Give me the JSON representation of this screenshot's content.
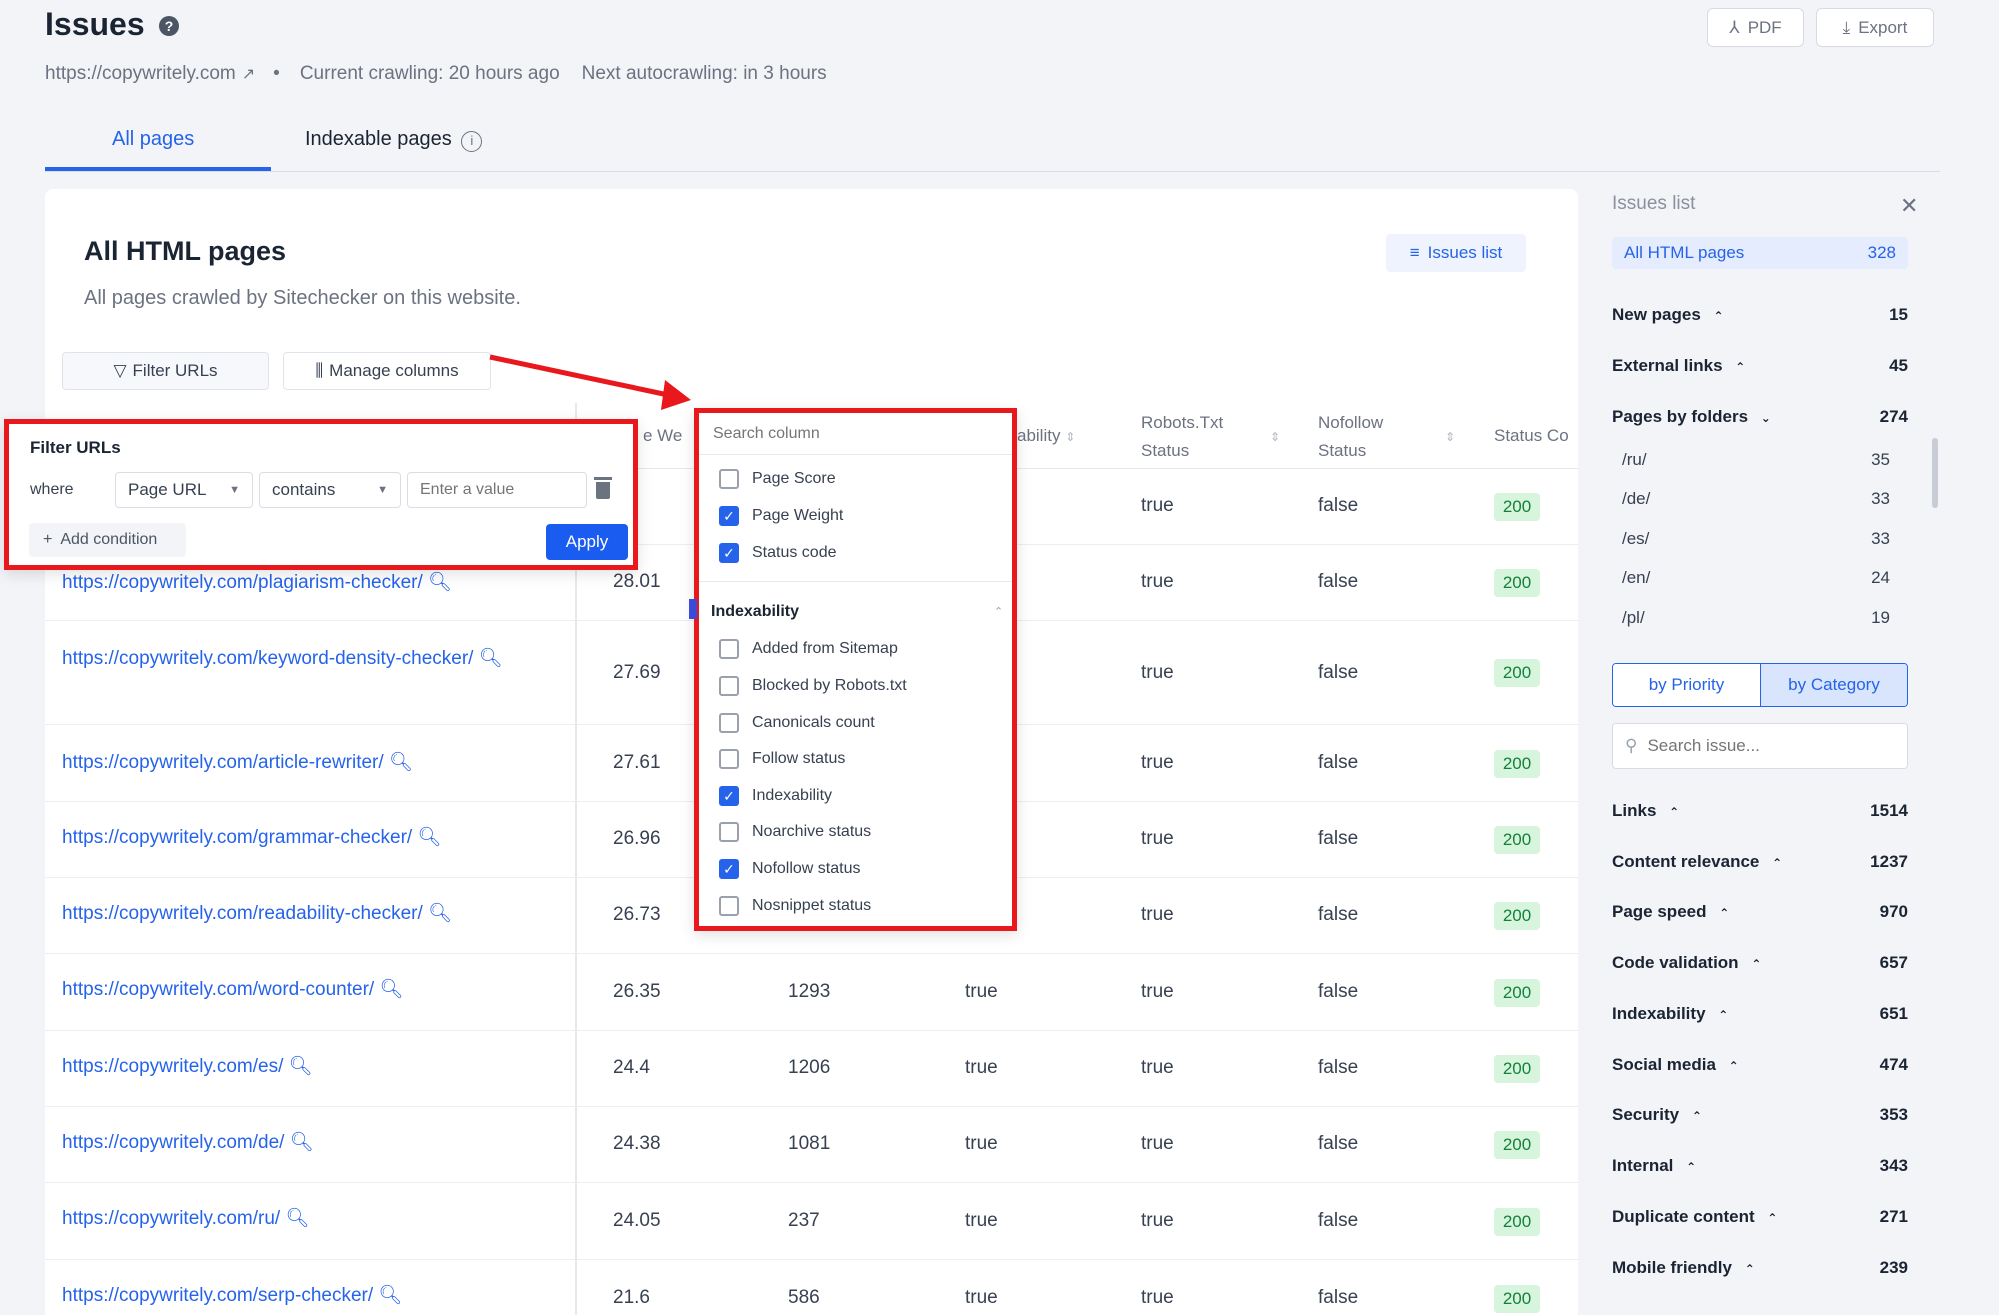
{
  "header": {
    "title": "Issues",
    "help": "?",
    "pdf_label": "PDF",
    "export_label": "Export",
    "site_url": "https://copywritely.com",
    "bullet": "•",
    "current_crawling": "Current crawling: 20 hours ago",
    "next_autocrawling": "Next autocrawling: in 3 hours"
  },
  "tabs": [
    {
      "label": "All pages",
      "active": true
    },
    {
      "label": "Indexable pages",
      "active": false
    }
  ],
  "main": {
    "title": "All HTML pages",
    "subtitle": "All pages crawled by Sitechecker on this website.",
    "issues_list_button": "Issues list",
    "filter_button": "Filter URLs",
    "manage_columns_button": "Manage columns"
  },
  "table": {
    "headers": {
      "weight": "e We",
      "indexability": "ability",
      "robots_line1": "Robots.Txt",
      "robots_line2": "Status",
      "nofollow_line1": "Nofollow",
      "nofollow_line2": "Status",
      "status_code": "Status Co"
    },
    "rows": [
      {
        "url": "",
        "score": "",
        "weight": "",
        "indexable": "",
        "robots": "true",
        "nofollow": "false",
        "status": "200"
      },
      {
        "url": "https://copywritely.com/plagiarism-checker/",
        "score": "28.01",
        "weight": "",
        "indexable": "",
        "robots": "true",
        "nofollow": "false",
        "status": "200"
      },
      {
        "url": "https://copywritely.com/keyword-density-checker/",
        "score": "27.69",
        "weight": "",
        "indexable": "",
        "robots": "true",
        "nofollow": "false",
        "status": "200"
      },
      {
        "url": "https://copywritely.com/article-rewriter/",
        "score": "27.61",
        "weight": "",
        "indexable": "",
        "robots": "true",
        "nofollow": "false",
        "status": "200"
      },
      {
        "url": "https://copywritely.com/grammar-checker/",
        "score": "26.96",
        "weight": "",
        "indexable": "",
        "robots": "true",
        "nofollow": "false",
        "status": "200"
      },
      {
        "url": "https://copywritely.com/readability-checker/",
        "score": "26.73",
        "weight": "",
        "indexable": "",
        "robots": "true",
        "nofollow": "false",
        "status": "200"
      },
      {
        "url": "https://copywritely.com/word-counter/",
        "score": "26.35",
        "weight": "1293",
        "indexable": "true",
        "robots": "true",
        "nofollow": "false",
        "status": "200"
      },
      {
        "url": "https://copywritely.com/es/",
        "score": "24.4",
        "weight": "1206",
        "indexable": "true",
        "robots": "true",
        "nofollow": "false",
        "status": "200"
      },
      {
        "url": "https://copywritely.com/de/",
        "score": "24.38",
        "weight": "1081",
        "indexable": "true",
        "robots": "true",
        "nofollow": "false",
        "status": "200"
      },
      {
        "url": "https://copywritely.com/ru/",
        "score": "24.05",
        "weight": "237",
        "indexable": "true",
        "robots": "true",
        "nofollow": "false",
        "status": "200"
      },
      {
        "url": "https://copywritely.com/serp-checker/",
        "score": "21.6",
        "weight": "586",
        "indexable": "true",
        "robots": "true",
        "nofollow": "false",
        "status": "200"
      }
    ]
  },
  "filter_popup": {
    "title": "Filter URLs",
    "where": "where",
    "field_value": "Page URL",
    "operator_value": "contains",
    "value_placeholder": "Enter a value",
    "add_condition": "Add condition",
    "apply": "Apply"
  },
  "columns_popup": {
    "search_placeholder": "Search column",
    "group1": [
      {
        "label": "Page Score",
        "checked": false
      },
      {
        "label": "Page Weight",
        "checked": true
      },
      {
        "label": "Status code",
        "checked": true
      }
    ],
    "section_title": "Indexability",
    "group2": [
      {
        "label": "Added from Sitemap",
        "checked": false
      },
      {
        "label": "Blocked by Robots.txt",
        "checked": false
      },
      {
        "label": "Canonicals count",
        "checked": false
      },
      {
        "label": "Follow status",
        "checked": false
      },
      {
        "label": "Indexability",
        "checked": true
      },
      {
        "label": "Noarchive status",
        "checked": false
      },
      {
        "label": "Nofollow status",
        "checked": true
      },
      {
        "label": "Nosnippet status",
        "checked": false
      }
    ]
  },
  "sidebar": {
    "title": "Issues list",
    "all_pages_label": "All HTML pages",
    "all_pages_count": "328",
    "top_groups": [
      {
        "label": "New pages",
        "count": "15"
      },
      {
        "label": "External links",
        "count": "45"
      },
      {
        "label": "Pages by folders",
        "count": "274"
      }
    ],
    "folders": [
      {
        "label": "/ru/",
        "count": "35"
      },
      {
        "label": "/de/",
        "count": "33"
      },
      {
        "label": "/es/",
        "count": "33"
      },
      {
        "label": "/en/",
        "count": "24"
      },
      {
        "label": "/pl/",
        "count": "19"
      }
    ],
    "toggle_priority": "by Priority",
    "toggle_category": "by Category",
    "search_placeholder": "Search issue...",
    "categories": [
      {
        "label": "Links",
        "count": "1514"
      },
      {
        "label": "Content relevance",
        "count": "1237"
      },
      {
        "label": "Page speed",
        "count": "970"
      },
      {
        "label": "Code validation",
        "count": "657"
      },
      {
        "label": "Indexability",
        "count": "651"
      },
      {
        "label": "Social media",
        "count": "474"
      },
      {
        "label": "Security",
        "count": "353"
      },
      {
        "label": "Internal",
        "count": "343"
      },
      {
        "label": "Duplicate content",
        "count": "271"
      },
      {
        "label": "Mobile friendly",
        "count": "239"
      }
    ]
  },
  "colors": {
    "accent": "#2563eb",
    "highlight": "#e8181c",
    "status_ok_bg": "#d7f5dc"
  }
}
